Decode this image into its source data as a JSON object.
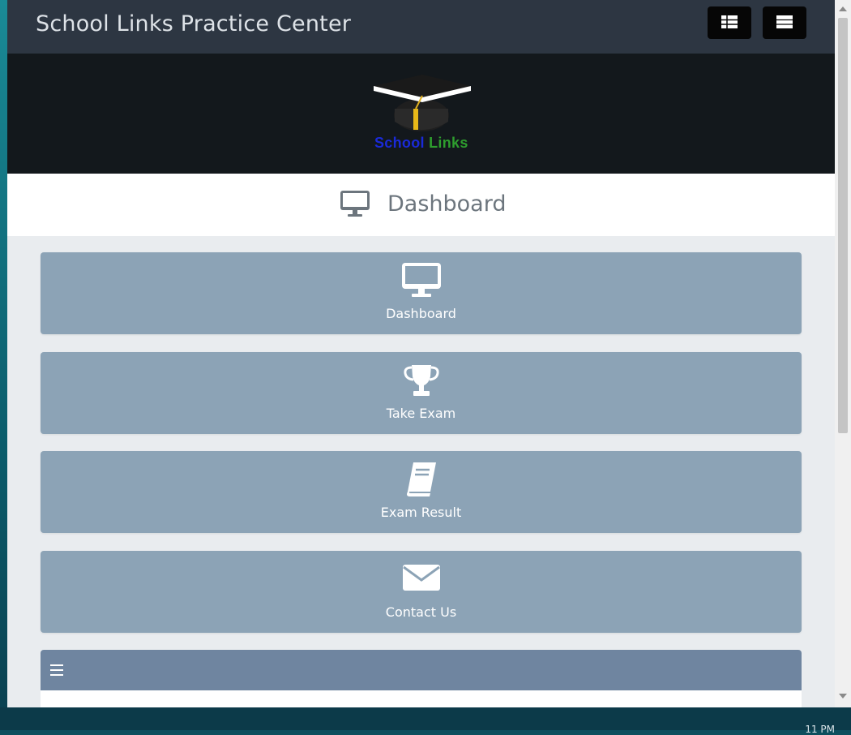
{
  "navbar": {
    "brand": "School Links Practice Center"
  },
  "banner": {
    "logo_text_part1": "School",
    "logo_text_part2": "Links"
  },
  "page_header": {
    "title": "Dashboard",
    "icon": "monitor-icon"
  },
  "tiles": [
    {
      "label": "Dashboard",
      "icon": "monitor-icon"
    },
    {
      "label": "Take Exam",
      "icon": "trophy-icon"
    },
    {
      "label": "Exam Result",
      "icon": "book-icon"
    },
    {
      "label": "Contact Us",
      "icon": "envelope-icon"
    }
  ],
  "taskbar": {
    "clock": "11 PM"
  },
  "colors": {
    "navbar": "#2d3642",
    "banner": "#13181c",
    "tile": "#8ca3b6",
    "panel_head": "#6f85a0",
    "page_bg": "#e9ecef"
  }
}
